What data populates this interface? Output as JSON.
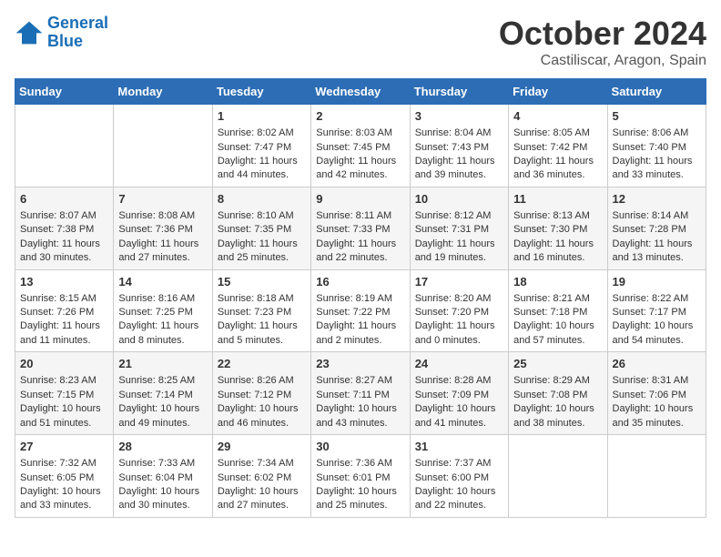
{
  "header": {
    "logo_line1": "General",
    "logo_line2": "Blue",
    "month": "October 2024",
    "location": "Castiliscar, Aragon, Spain"
  },
  "days_of_week": [
    "Sunday",
    "Monday",
    "Tuesday",
    "Wednesday",
    "Thursday",
    "Friday",
    "Saturday"
  ],
  "weeks": [
    [
      {
        "day": "",
        "info": ""
      },
      {
        "day": "",
        "info": ""
      },
      {
        "day": "1",
        "info": "Sunrise: 8:02 AM\nSunset: 7:47 PM\nDaylight: 11 hours and 44 minutes."
      },
      {
        "day": "2",
        "info": "Sunrise: 8:03 AM\nSunset: 7:45 PM\nDaylight: 11 hours and 42 minutes."
      },
      {
        "day": "3",
        "info": "Sunrise: 8:04 AM\nSunset: 7:43 PM\nDaylight: 11 hours and 39 minutes."
      },
      {
        "day": "4",
        "info": "Sunrise: 8:05 AM\nSunset: 7:42 PM\nDaylight: 11 hours and 36 minutes."
      },
      {
        "day": "5",
        "info": "Sunrise: 8:06 AM\nSunset: 7:40 PM\nDaylight: 11 hours and 33 minutes."
      }
    ],
    [
      {
        "day": "6",
        "info": "Sunrise: 8:07 AM\nSunset: 7:38 PM\nDaylight: 11 hours and 30 minutes."
      },
      {
        "day": "7",
        "info": "Sunrise: 8:08 AM\nSunset: 7:36 PM\nDaylight: 11 hours and 27 minutes."
      },
      {
        "day": "8",
        "info": "Sunrise: 8:10 AM\nSunset: 7:35 PM\nDaylight: 11 hours and 25 minutes."
      },
      {
        "day": "9",
        "info": "Sunrise: 8:11 AM\nSunset: 7:33 PM\nDaylight: 11 hours and 22 minutes."
      },
      {
        "day": "10",
        "info": "Sunrise: 8:12 AM\nSunset: 7:31 PM\nDaylight: 11 hours and 19 minutes."
      },
      {
        "day": "11",
        "info": "Sunrise: 8:13 AM\nSunset: 7:30 PM\nDaylight: 11 hours and 16 minutes."
      },
      {
        "day": "12",
        "info": "Sunrise: 8:14 AM\nSunset: 7:28 PM\nDaylight: 11 hours and 13 minutes."
      }
    ],
    [
      {
        "day": "13",
        "info": "Sunrise: 8:15 AM\nSunset: 7:26 PM\nDaylight: 11 hours and 11 minutes."
      },
      {
        "day": "14",
        "info": "Sunrise: 8:16 AM\nSunset: 7:25 PM\nDaylight: 11 hours and 8 minutes."
      },
      {
        "day": "15",
        "info": "Sunrise: 8:18 AM\nSunset: 7:23 PM\nDaylight: 11 hours and 5 minutes."
      },
      {
        "day": "16",
        "info": "Sunrise: 8:19 AM\nSunset: 7:22 PM\nDaylight: 11 hours and 2 minutes."
      },
      {
        "day": "17",
        "info": "Sunrise: 8:20 AM\nSunset: 7:20 PM\nDaylight: 11 hours and 0 minutes."
      },
      {
        "day": "18",
        "info": "Sunrise: 8:21 AM\nSunset: 7:18 PM\nDaylight: 10 hours and 57 minutes."
      },
      {
        "day": "19",
        "info": "Sunrise: 8:22 AM\nSunset: 7:17 PM\nDaylight: 10 hours and 54 minutes."
      }
    ],
    [
      {
        "day": "20",
        "info": "Sunrise: 8:23 AM\nSunset: 7:15 PM\nDaylight: 10 hours and 51 minutes."
      },
      {
        "day": "21",
        "info": "Sunrise: 8:25 AM\nSunset: 7:14 PM\nDaylight: 10 hours and 49 minutes."
      },
      {
        "day": "22",
        "info": "Sunrise: 8:26 AM\nSunset: 7:12 PM\nDaylight: 10 hours and 46 minutes."
      },
      {
        "day": "23",
        "info": "Sunrise: 8:27 AM\nSunset: 7:11 PM\nDaylight: 10 hours and 43 minutes."
      },
      {
        "day": "24",
        "info": "Sunrise: 8:28 AM\nSunset: 7:09 PM\nDaylight: 10 hours and 41 minutes."
      },
      {
        "day": "25",
        "info": "Sunrise: 8:29 AM\nSunset: 7:08 PM\nDaylight: 10 hours and 38 minutes."
      },
      {
        "day": "26",
        "info": "Sunrise: 8:31 AM\nSunset: 7:06 PM\nDaylight: 10 hours and 35 minutes."
      }
    ],
    [
      {
        "day": "27",
        "info": "Sunrise: 7:32 AM\nSunset: 6:05 PM\nDaylight: 10 hours and 33 minutes."
      },
      {
        "day": "28",
        "info": "Sunrise: 7:33 AM\nSunset: 6:04 PM\nDaylight: 10 hours and 30 minutes."
      },
      {
        "day": "29",
        "info": "Sunrise: 7:34 AM\nSunset: 6:02 PM\nDaylight: 10 hours and 27 minutes."
      },
      {
        "day": "30",
        "info": "Sunrise: 7:36 AM\nSunset: 6:01 PM\nDaylight: 10 hours and 25 minutes."
      },
      {
        "day": "31",
        "info": "Sunrise: 7:37 AM\nSunset: 6:00 PM\nDaylight: 10 hours and 22 minutes."
      },
      {
        "day": "",
        "info": ""
      },
      {
        "day": "",
        "info": ""
      }
    ]
  ]
}
